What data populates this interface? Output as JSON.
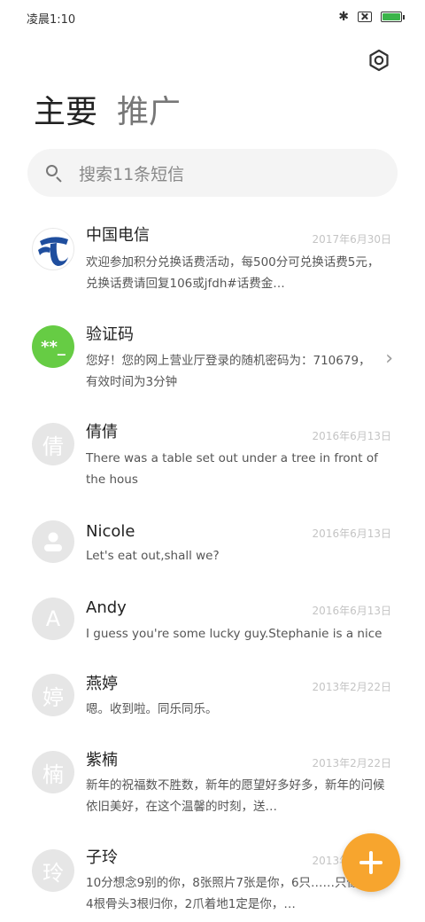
{
  "status_bar": {
    "time": "凌晨1:10",
    "icons": [
      "bluetooth-icon",
      "sim-card-icon",
      "battery-charging-icon"
    ],
    "battery_color": "#3bb44a"
  },
  "header": {
    "settings_icon": "settings-icon",
    "tabs": [
      {
        "label": "主要",
        "active": true
      },
      {
        "label": "推广",
        "active": false
      }
    ]
  },
  "search": {
    "placeholder": "搜索11条短信"
  },
  "conversations": [
    {
      "sender": "中国电信",
      "date": "2017年6月30日",
      "preview": "欢迎参加积分兑换话费活动，每500分可兑换话费5元，兑换话费请回复106或jfdh#话费金…",
      "avatar": "china-telecom-logo"
    },
    {
      "sender": "验证码",
      "date": "",
      "preview": "您好！您的网上营业厅登录的随机密码为：710679，有效时间为3分钟",
      "avatar": "**_"
    },
    {
      "sender": "倩倩",
      "date": "2016年6月13日",
      "preview": "There was a table set out under a tree in front of the hous",
      "avatar": "倩"
    },
    {
      "sender": "Nicole",
      "date": "2016年6月13日",
      "preview": "Let's eat out,shall we?",
      "avatar": "person-icon"
    },
    {
      "sender": "Andy",
      "date": "2016年6月13日",
      "preview": "I guess you're some lucky guy.Stephanie is a nice girl.",
      "avatar": "A"
    },
    {
      "sender": "燕婷",
      "date": "2013年2月22日",
      "preview": "嗯。收到啦。同乐同乐。",
      "avatar": "婷"
    },
    {
      "sender": "紫楠",
      "date": "2013年2月22日",
      "preview": "新年的祝福数不胜数，新年的愿望好多好多，新年的问候依旧美好，在这个温馨的时刻，送…",
      "avatar": "楠"
    },
    {
      "sender": "子玲",
      "date": "2013年2月22日",
      "preview": "10分想念9别的你，8张照片7张是你，6只……只像你，4根骨头3根归你，2爪着地1定是你，…",
      "avatar": "玲"
    }
  ],
  "fab": {
    "icon": "plus-icon",
    "color": "#f7a52e"
  }
}
